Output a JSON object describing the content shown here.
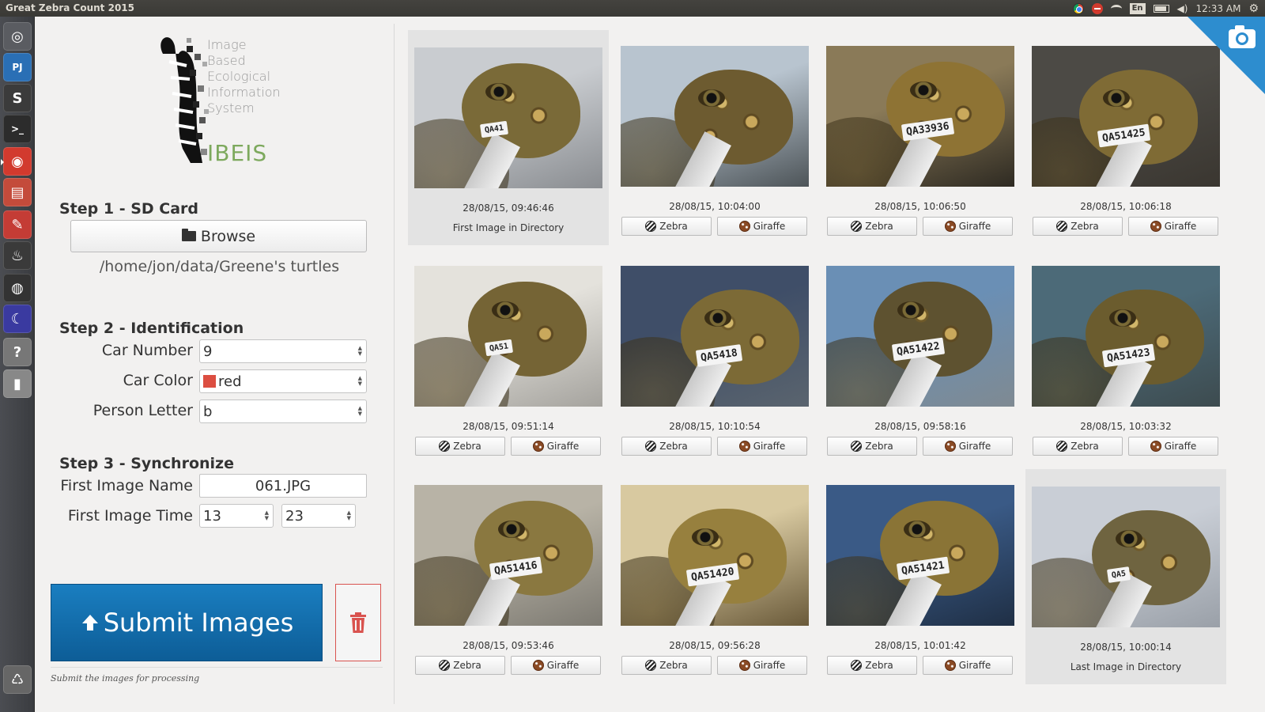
{
  "window": {
    "title": "Great Zebra Count 2015"
  },
  "system_tray": {
    "keyboard": "En",
    "time": "12:33 AM"
  },
  "launcher": {
    "items": [
      {
        "name": "dash",
        "glyph": "◎",
        "bg": "#5a5c61"
      },
      {
        "name": "pycharm",
        "glyph": "PJ",
        "bg": "#2a6fb5"
      },
      {
        "name": "sublime",
        "glyph": "S",
        "bg": "#3b3b3b"
      },
      {
        "name": "terminal",
        "glyph": ">_",
        "bg": "#2c2c2c"
      },
      {
        "name": "chrome",
        "glyph": "◉",
        "bg": "#d23a2e"
      },
      {
        "name": "files",
        "glyph": "▤",
        "bg": "#c44b3b"
      },
      {
        "name": "settings",
        "glyph": "✎",
        "bg": "#c43c35"
      },
      {
        "name": "steam",
        "glyph": "♨",
        "bg": "#3a3a3a"
      },
      {
        "name": "ble",
        "glyph": "◍",
        "bg": "#333"
      },
      {
        "name": "stellarium",
        "glyph": "☾",
        "bg": "#3a3aa0"
      },
      {
        "name": "help",
        "glyph": "?",
        "bg": "#777"
      },
      {
        "name": "usb",
        "glyph": "▮",
        "bg": "#888"
      },
      {
        "name": "trash",
        "glyph": "♺",
        "bg": "#666"
      }
    ]
  },
  "logo": {
    "lines": [
      "Image",
      "Based",
      "Ecological",
      "Information",
      "System"
    ],
    "acronym": "IBEIS"
  },
  "step1": {
    "heading": "Step 1 - SD Card",
    "browse_label": "Browse",
    "path": "/home/jon/data/Greene's turtles"
  },
  "step2": {
    "heading": "Step 2 - Identification",
    "car_number_label": "Car Number",
    "car_number_value": "9",
    "car_color_label": "Car Color",
    "car_color_value": "red",
    "car_color_hex": "#dc4e41",
    "person_letter_label": "Person Letter",
    "person_letter_value": "b"
  },
  "step3": {
    "heading": "Step 3 - Synchronize",
    "first_image_name_label": "First Image Name",
    "first_image_name_value": "061.JPG",
    "first_image_time_label": "First Image Time",
    "hour_value": "13",
    "minute_value": "23"
  },
  "submit": {
    "label": "Submit Images",
    "note": "Submit the images for processing",
    "color": "#1a7ec0"
  },
  "buttons": {
    "zebra": "Zebra",
    "giraffe": "Giraffe"
  },
  "images": [
    {
      "timestamp": "28/08/15, 09:46:46",
      "caption": "First Image in Directory",
      "tag": "QA41",
      "highlight": true
    },
    {
      "timestamp": "28/08/15, 10:04:00",
      "caption": "",
      "tag": "",
      "highlight": false
    },
    {
      "timestamp": "28/08/15, 10:06:50",
      "caption": "",
      "tag": "QA33936",
      "highlight": false
    },
    {
      "timestamp": "28/08/15, 10:06:18",
      "caption": "",
      "tag": "QA51425",
      "highlight": false
    },
    {
      "timestamp": "28/08/15, 09:51:14",
      "caption": "",
      "tag": "QA51",
      "highlight": false
    },
    {
      "timestamp": "28/08/15, 10:10:54",
      "caption": "",
      "tag": "QA5418",
      "highlight": false
    },
    {
      "timestamp": "28/08/15, 09:58:16",
      "caption": "",
      "tag": "QA51422",
      "highlight": false
    },
    {
      "timestamp": "28/08/15, 10:03:32",
      "caption": "",
      "tag": "QA51423",
      "highlight": false
    },
    {
      "timestamp": "28/08/15, 09:53:46",
      "caption": "",
      "tag": "QA51416",
      "highlight": false
    },
    {
      "timestamp": "28/08/15, 09:56:28",
      "caption": "",
      "tag": "QA51420",
      "highlight": false
    },
    {
      "timestamp": "28/08/15, 10:01:42",
      "caption": "",
      "tag": "QA51421",
      "highlight": false
    },
    {
      "timestamp": "28/08/15, 10:00:14",
      "caption": "Last Image in Directory",
      "tag": "QA5",
      "highlight": true
    }
  ]
}
